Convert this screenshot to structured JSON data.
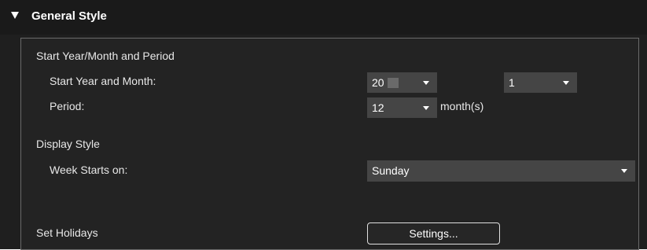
{
  "header": {
    "title": "General Style"
  },
  "start_period": {
    "section_label": "Start Year/Month and Period",
    "start_year_month_label": "Start Year and Month:",
    "year_value": "20",
    "month_value": "1",
    "period_label": "Period:",
    "period_value": "12",
    "period_unit": "month(s)"
  },
  "display_style": {
    "section_label": "Display Style",
    "week_starts_label": "Week Starts on:",
    "week_starts_value": "Sunday"
  },
  "holidays": {
    "label": "Set Holidays",
    "settings_button": "Settings..."
  }
}
